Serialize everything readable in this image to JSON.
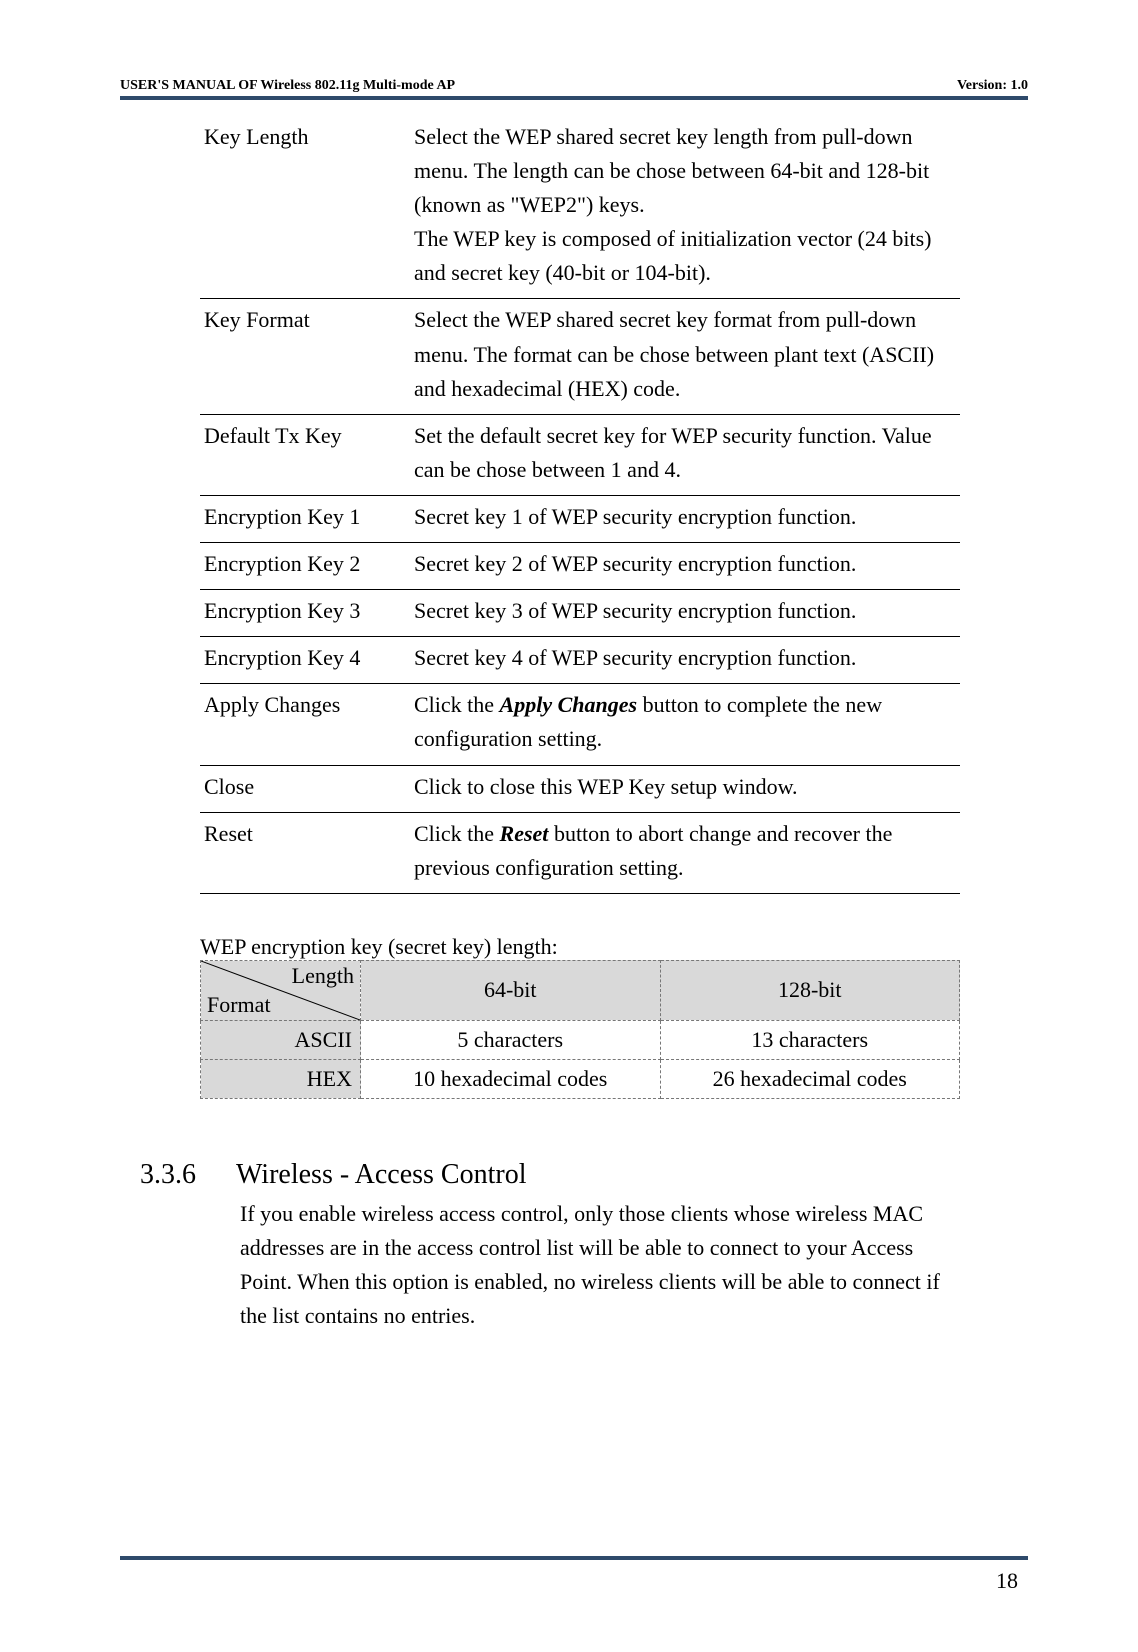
{
  "header": {
    "title": "USER'S MANUAL OF Wireless 802.11g Multi-mode AP",
    "version": "Version: 1.0"
  },
  "definitions": [
    {
      "label": "Key Length",
      "desc": "Select the WEP shared secret key length from pull-down menu. The length can be chose between 64-bit and 128-bit (known as \"WEP2\") keys.\nThe WEP key is composed of initialization vector (24 bits) and secret key (40-bit or 104-bit)."
    },
    {
      "label": "Key Format",
      "desc": "Select the WEP shared secret key format from pull-down menu. The format can be chose between plant text (ASCII) and hexadecimal (HEX) code."
    },
    {
      "label": "Default Tx Key",
      "desc": "Set the default secret key for WEP security function. Value can be chose between 1 and 4."
    },
    {
      "label": "Encryption Key 1",
      "desc": "Secret key 1 of WEP security encryption function."
    },
    {
      "label": "Encryption Key 2",
      "desc": "Secret key 2 of WEP security encryption function."
    },
    {
      "label": "Encryption Key 3",
      "desc": "Secret key 3 of WEP security encryption function."
    },
    {
      "label": "Encryption Key 4",
      "desc": "Secret key 4 of WEP security encryption function."
    },
    {
      "label": "Apply Changes",
      "desc_pre": "Click the ",
      "desc_em": "Apply Changes",
      "desc_post": " button to complete the new configuration setting."
    },
    {
      "label": "Close",
      "desc": "Click to close this WEP Key setup window."
    },
    {
      "label": "Reset",
      "desc_pre": "Click the ",
      "desc_em": "Reset",
      "desc_post": " button to abort change and recover the previous configuration setting."
    }
  ],
  "wep_caption": "WEP encryption key (secret key) length:",
  "length_table": {
    "diag_top": "Length",
    "diag_bot": "Format",
    "col1": "64-bit",
    "col2": "128-bit",
    "rows": [
      {
        "h": "ASCII",
        "c1": "5 characters",
        "c2": "13 characters"
      },
      {
        "h": "HEX",
        "c1": "10 hexadecimal codes",
        "c2": "26 hexadecimal codes"
      }
    ]
  },
  "section": {
    "num": "3.3.6",
    "title": "Wireless - Access Control",
    "body": "If you enable wireless access control, only those clients whose wireless MAC addresses are in the access control list will be able to connect to your Access Point. When this option is enabled, no wireless clients will be able to connect if the list contains no entries."
  },
  "page_number": "18"
}
